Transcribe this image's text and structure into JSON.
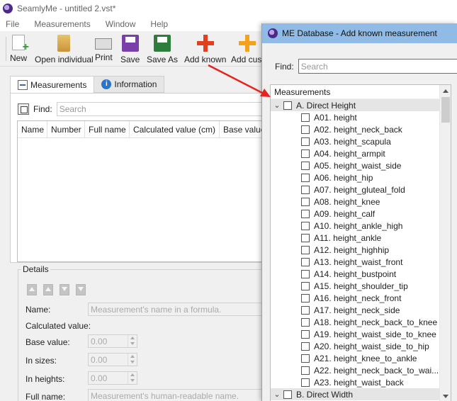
{
  "main_window": {
    "title": "SeamlyMe - untitled 2.vst*",
    "menu": [
      "File",
      "Measurements",
      "Window",
      "Help"
    ],
    "toolbar": {
      "new": "New",
      "open_individual": "Open individual",
      "print": "Print",
      "save": "Save",
      "save_as": "Save As",
      "add_known": "Add known",
      "add_custom": "Add cust"
    },
    "tabs": {
      "measurements": "Measurements",
      "information": "Information"
    },
    "find_label": "Find:",
    "search_placeholder": "Search",
    "table_columns": [
      "Name",
      "Number",
      "Full name",
      "Calculated value (cm)",
      "Base value"
    ],
    "details": {
      "title": "Details",
      "name_label": "Name:",
      "name_placeholder": "Measurement's name in a formula.",
      "calculated_label": "Calculated value:",
      "base_value_label": "Base value:",
      "base_value": "0.00",
      "in_sizes_label": "In sizes:",
      "in_sizes": "0.00",
      "in_heights_label": "In heights:",
      "in_heights": "0.00",
      "full_name_label": "Full name:",
      "full_name_placeholder": "Measurement's human-readable name."
    }
  },
  "dialog": {
    "title": "ME Database - Add known measurement",
    "find_label": "Find:",
    "search_placeholder": "Search",
    "tree_header": "Measurements",
    "groups": [
      {
        "label": "A. Direct Height",
        "expanded": true,
        "items": [
          "A01. height",
          "A02. height_neck_back",
          "A03. height_scapula",
          "A04. height_armpit",
          "A05. height_waist_side",
          "A06. height_hip",
          "A07. height_gluteal_fold",
          "A08. height_knee",
          "A09. height_calf",
          "A10. height_ankle_high",
          "A11. height_ankle",
          "A12. height_highhip",
          "A13. height_waist_front",
          "A14. height_bustpoint",
          "A15. height_shoulder_tip",
          "A16. height_neck_front",
          "A17. height_neck_side",
          "A18. height_neck_back_to_knee",
          "A19. height_waist_side_to_knee",
          "A20. height_waist_side_to_hip",
          "A21. height_knee_to_ankle",
          "A22. height_neck_back_to_wai...",
          "A23. height_waist_back"
        ]
      },
      {
        "label": "B. Direct Width",
        "expanded": true,
        "items": []
      }
    ]
  },
  "colors": {
    "dialog_title_bar": "#8fbbe6",
    "annotation_arrow": "#e8231f",
    "add_known_icon": "#e0401d",
    "add_custom_icon": "#f3a21a"
  }
}
